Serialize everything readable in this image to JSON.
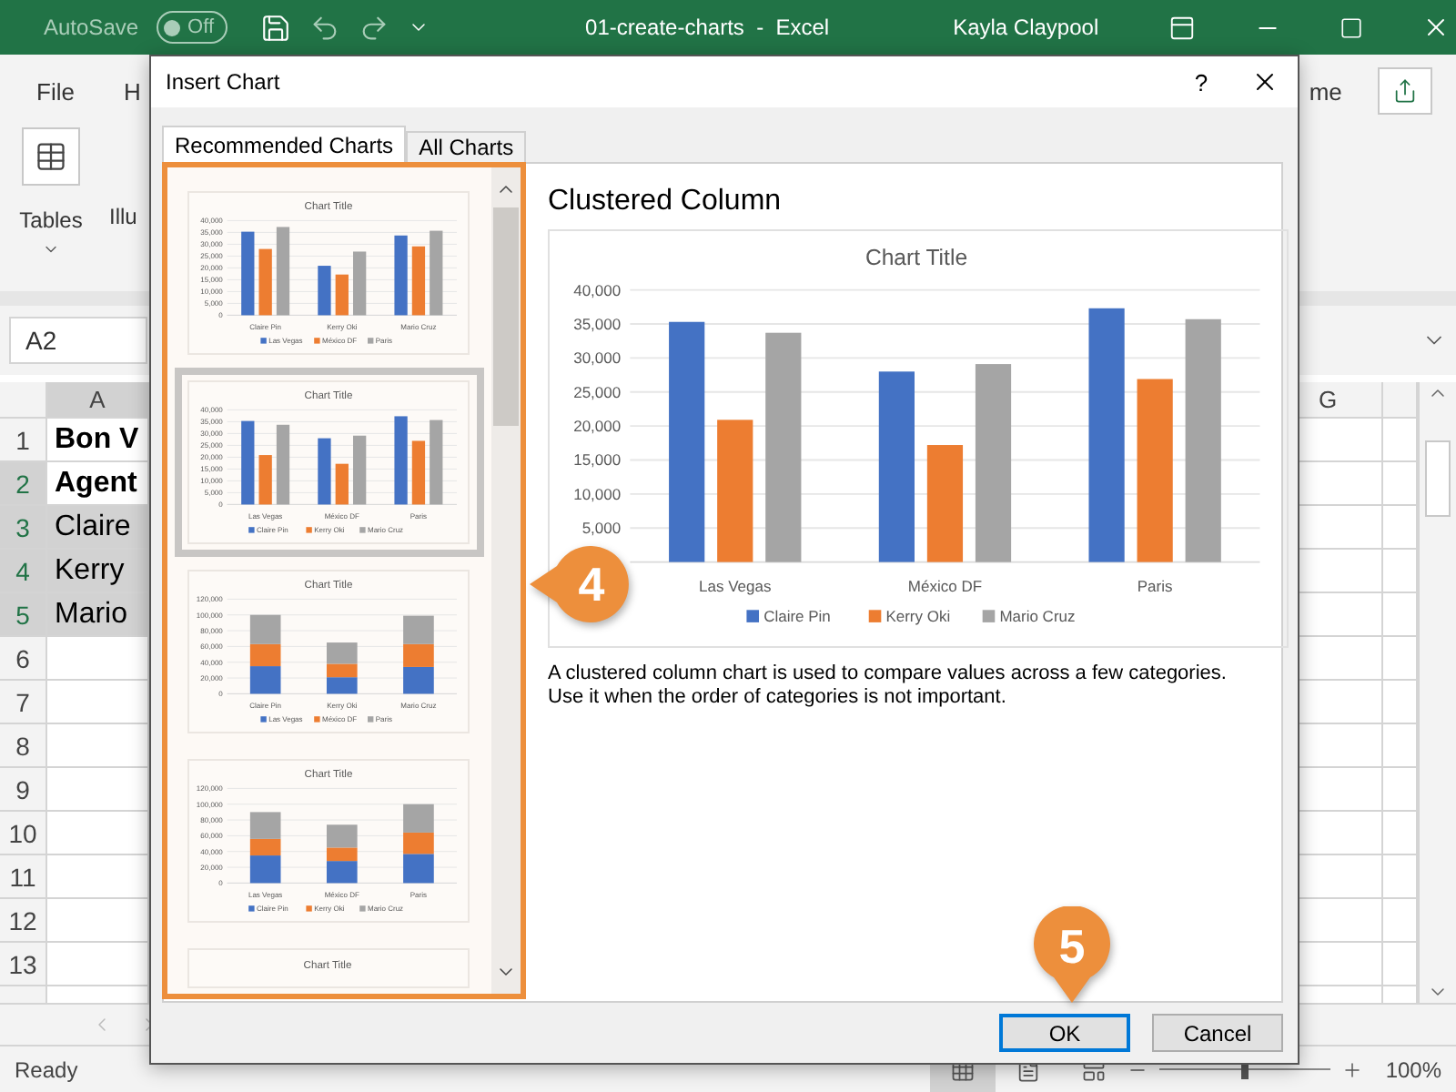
{
  "excel": {
    "title_bar": {
      "autosave_label": "AutoSave",
      "autosave": {
        "on": false,
        "label": "Off"
      },
      "title": "01-create-charts  -  Excel",
      "user": "Kayla Claypool"
    },
    "ribbon": {
      "tabs": [
        "File",
        "H",
        "me"
      ],
      "groups": [
        {
          "label": "Tables"
        },
        {
          "label": "Illu"
        }
      ]
    },
    "name_box": "A2",
    "columns": [
      "A",
      "G"
    ],
    "rows": [
      {
        "number": "1",
        "cell": "Bon V",
        "bold": true,
        "selected": false
      },
      {
        "number": "2",
        "cell": "Agent",
        "bold": true,
        "selected": true
      },
      {
        "number": "3",
        "cell": "Claire",
        "bold": false,
        "selected": true
      },
      {
        "number": "4",
        "cell": "Kerry",
        "bold": false,
        "selected": true
      },
      {
        "number": "5",
        "cell": "Mario",
        "bold": false,
        "selected": true
      },
      {
        "number": "6",
        "selected": false
      },
      {
        "number": "7",
        "selected": false
      },
      {
        "number": "8",
        "selected": false
      },
      {
        "number": "9",
        "selected": false
      },
      {
        "number": "10",
        "selected": false
      },
      {
        "number": "11",
        "selected": false
      },
      {
        "number": "12",
        "selected": false
      },
      {
        "number": "13",
        "selected": false
      }
    ],
    "status_bar": {
      "status": "Ready",
      "zoom_slider": {
        "level": 0.5
      },
      "zoom": "100%"
    }
  },
  "dialog": {
    "title": "Insert Chart",
    "help": "?",
    "tabs": [
      {
        "label": "Recommended Charts",
        "selected": true
      },
      {
        "label": "All Charts",
        "selected": false
      }
    ],
    "thumbnails": [
      {
        "selected": false,
        "chart_data": {
          "type": "bar",
          "title": "Chart Title",
          "categories": [
            "Claire Pin",
            "Kerry Oki",
            "Mario Cruz"
          ],
          "stacked": false,
          "grid": true,
          "legend": true,
          "ylim": [
            0,
            40000
          ],
          "yticks": [
            {
              "value": 0,
              "label": "0"
            },
            {
              "value": 5000,
              "label": "5,000"
            },
            {
              "value": 10000,
              "label": "10,000"
            },
            {
              "value": 15000,
              "label": "15,000"
            },
            {
              "value": 20000,
              "label": "20,000"
            },
            {
              "value": 25000,
              "label": "25,000"
            },
            {
              "value": 30000,
              "label": "30,000"
            },
            {
              "value": 35000,
              "label": "35,000"
            },
            {
              "value": 40000,
              "label": "40,000"
            }
          ],
          "series": [
            {
              "name": "Las Vegas",
              "color": "#4472c4",
              "values": [
                35300,
                20900,
                33700
              ]
            },
            {
              "name": "México DF",
              "color": "#ed7d31",
              "values": [
                28000,
                17200,
                29100
              ]
            },
            {
              "name": "Paris",
              "color": "#a5a5a5",
              "values": [
                37300,
                26900,
                35700
              ]
            }
          ]
        }
      },
      {
        "selected": true,
        "chart_data": {
          "type": "bar",
          "title": "Chart Title",
          "categories": [
            "Las Vegas",
            "México DF",
            "Paris"
          ],
          "stacked": false,
          "grid": true,
          "legend": true,
          "ylim": [
            0,
            40000
          ],
          "yticks": [
            {
              "value": 0,
              "label": "0"
            },
            {
              "value": 5000,
              "label": "5,000"
            },
            {
              "value": 10000,
              "label": "10,000"
            },
            {
              "value": 15000,
              "label": "15,000"
            },
            {
              "value": 20000,
              "label": "20,000"
            },
            {
              "value": 25000,
              "label": "25,000"
            },
            {
              "value": 30000,
              "label": "30,000"
            },
            {
              "value": 35000,
              "label": "35,000"
            },
            {
              "value": 40000,
              "label": "40,000"
            }
          ],
          "series": [
            {
              "name": "Claire Pin",
              "color": "#4472c4",
              "values": [
                35300,
                28000,
                37300
              ]
            },
            {
              "name": "Kerry Oki",
              "color": "#ed7d31",
              "values": [
                20900,
                17200,
                26900
              ]
            },
            {
              "name": "Mario Cruz",
              "color": "#a5a5a5",
              "values": [
                33700,
                29100,
                35700
              ]
            }
          ]
        }
      },
      {
        "selected": false,
        "chart_data": {
          "type": "bar",
          "title": "Chart Title",
          "categories": [
            "Claire Pin",
            "Kerry Oki",
            "Mario Cruz"
          ],
          "stacked": true,
          "grid": true,
          "legend": true,
          "ylim": [
            0,
            120000
          ],
          "yticks": [
            {
              "value": 0,
              "label": "0"
            },
            {
              "value": 20000,
              "label": "20,000"
            },
            {
              "value": 40000,
              "label": "40,000"
            },
            {
              "value": 60000,
              "label": "60,000"
            },
            {
              "value": 80000,
              "label": "80,000"
            },
            {
              "value": 100000,
              "label": "100,000"
            },
            {
              "value": 120000,
              "label": "120,000"
            }
          ],
          "series": [
            {
              "name": "Las Vegas",
              "color": "#4472c4",
              "values": [
                35000,
                21000,
                34000
              ]
            },
            {
              "name": "México DF",
              "color": "#ed7d31",
              "values": [
                28000,
                17000,
                29000
              ]
            },
            {
              "name": "Paris",
              "color": "#a5a5a5",
              "values": [
                37000,
                27000,
                36000
              ]
            }
          ]
        }
      },
      {
        "selected": false,
        "chart_data": {
          "type": "bar",
          "title": "Chart Title",
          "categories": [
            "Las Vegas",
            "México DF",
            "Paris"
          ],
          "stacked": true,
          "grid": true,
          "legend": true,
          "ylim": [
            0,
            120000
          ],
          "yticks": [
            {
              "value": 0,
              "label": "0"
            },
            {
              "value": 20000,
              "label": "20,000"
            },
            {
              "value": 40000,
              "label": "40,000"
            },
            {
              "value": 60000,
              "label": "60,000"
            },
            {
              "value": 80000,
              "label": "80,000"
            },
            {
              "value": 100000,
              "label": "100,000"
            },
            {
              "value": 120000,
              "label": "120,000"
            }
          ],
          "series": [
            {
              "name": "Claire Pin",
              "color": "#4472c4",
              "values": [
                35000,
                28000,
                37000
              ]
            },
            {
              "name": "Kerry Oki",
              "color": "#ed7d31",
              "values": [
                21000,
                17000,
                27000
              ]
            },
            {
              "name": "Mario Cruz",
              "color": "#a5a5a5",
              "values": [
                34000,
                29000,
                36000
              ]
            }
          ]
        }
      },
      {
        "selected": false,
        "title": "Chart Title"
      }
    ],
    "preview": {
      "title": "Clustered Column",
      "chart_data": {
        "type": "bar",
        "title": "Chart Title",
        "categories": [
          "Las Vegas",
          "México DF",
          "Paris"
        ],
        "stacked": false,
        "grid": true,
        "legend": true,
        "ylim": [
          0,
          40000
        ],
        "yticks": [
          {
            "value": 5000,
            "label": "5,000"
          },
          {
            "value": 10000,
            "label": "10,000"
          },
          {
            "value": 15000,
            "label": "15,000"
          },
          {
            "value": 20000,
            "label": "20,000"
          },
          {
            "value": 25000,
            "label": "25,000"
          },
          {
            "value": 30000,
            "label": "30,000"
          },
          {
            "value": 35000,
            "label": "35,000"
          },
          {
            "value": 40000,
            "label": "40,000"
          }
        ],
        "series": [
          {
            "name": "Claire Pin",
            "color": "#4472c4",
            "values": [
              35300,
              28000,
              37300
            ]
          },
          {
            "name": "Kerry Oki",
            "color": "#ed7d31",
            "values": [
              20900,
              17200,
              26900
            ]
          },
          {
            "name": "Mario Cruz",
            "color": "#a5a5a5",
            "values": [
              33700,
              29100,
              35700
            ]
          }
        ]
      },
      "description": "A clustered column chart is used to compare values across a few categories. Use it when the order of categories is not important."
    },
    "buttons": [
      {
        "label": "OK",
        "focused": true
      },
      {
        "label": "Cancel",
        "focused": false
      }
    ]
  },
  "callouts": [
    {
      "number": "4"
    },
    {
      "number": "5"
    }
  ]
}
